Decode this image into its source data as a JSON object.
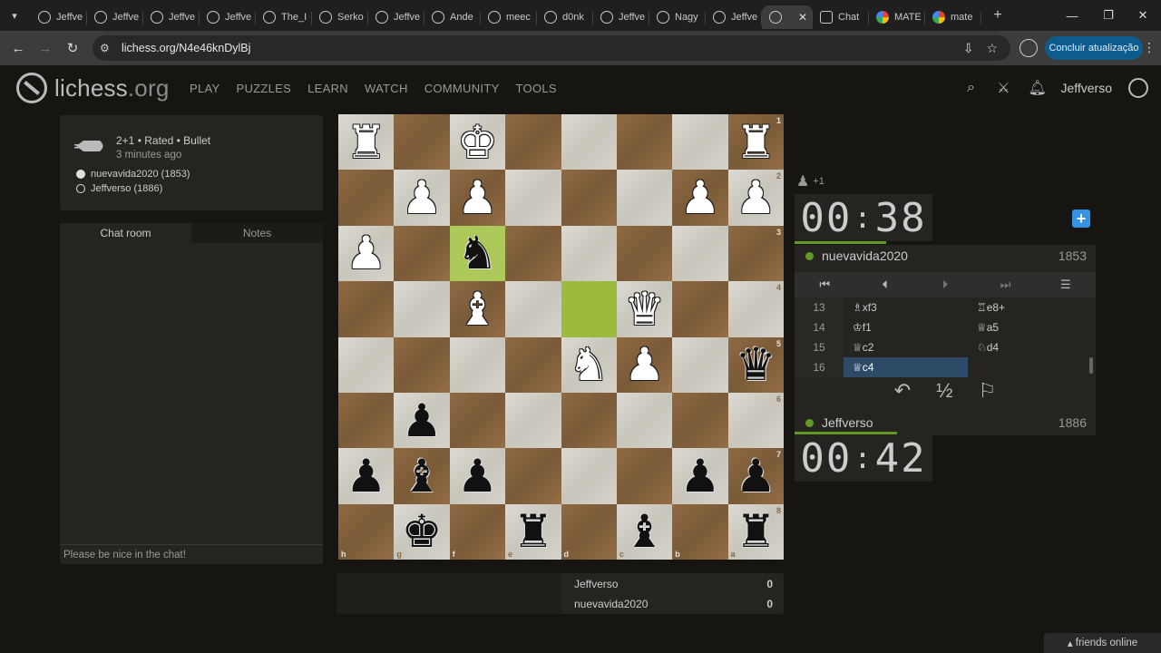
{
  "browser": {
    "tabs": [
      "Jeffve",
      "Jeffve",
      "Jeffve",
      "Jeffve",
      "The_I",
      "Serko",
      "Jeffve",
      "Ande",
      "meec",
      "d0nk",
      "Jeffve",
      "Nagy",
      "Jeffve",
      "",
      "Chat",
      "MATE",
      "mate"
    ],
    "active_tab_index": 13,
    "url": "lichess.org/N4e46knDylBj",
    "update_label": "Concluir atualização"
  },
  "site": {
    "logo_main": "lichess",
    "logo_suffix": ".org",
    "nav": [
      "PLAY",
      "PUZZLES",
      "LEARN",
      "WATCH",
      "COMMUNITY",
      "TOOLS"
    ],
    "username": "Jeffverso"
  },
  "game_meta": {
    "line1": "2+1 • Rated • Bullet",
    "line2": "3 minutes ago",
    "white_player": "nuevavida2020 (1853)",
    "black_player": "Jeffverso (1886)"
  },
  "chat": {
    "tab_chat": "Chat room",
    "tab_notes": "Notes",
    "placeholder": "Please be nice in the chat!"
  },
  "board": {
    "rows": [
      [
        "wR",
        "",
        "wK",
        "",
        "",
        "",
        "",
        "wR"
      ],
      [
        "",
        "wP",
        "wP",
        "",
        "",
        "",
        "wP",
        "wP"
      ],
      [
        "wP",
        "",
        "bN",
        "",
        "",
        "",
        "",
        ""
      ],
      [
        "",
        "",
        "wB",
        "",
        "",
        "wQ",
        "",
        ""
      ],
      [
        "",
        "",
        "",
        "",
        "wN",
        "wP",
        "",
        "bQ"
      ],
      [
        "",
        "bP",
        "",
        "",
        "",
        "",
        "",
        ""
      ],
      [
        "bP",
        "bB",
        "bP",
        "",
        "",
        "",
        "bP",
        "bP"
      ],
      [
        "",
        "bK",
        "",
        "bR",
        "",
        "bB",
        "",
        "bR"
      ]
    ],
    "highlight": [
      [
        2,
        2
      ],
      [
        3,
        4
      ]
    ],
    "ranks": [
      "1",
      "2",
      "3",
      "4",
      "5",
      "6",
      "7",
      "8"
    ],
    "files": [
      "h",
      "g",
      "f",
      "e",
      "d",
      "c",
      "b",
      "a"
    ]
  },
  "crosstable": [
    {
      "name": "Jeffverso",
      "score": "0"
    },
    {
      "name": "nuevavida2020",
      "score": "0"
    }
  ],
  "material": "+1",
  "top_clock": {
    "min": "00",
    "sec": "38"
  },
  "top_player": {
    "name": "nuevavida2020",
    "rating": "1853"
  },
  "bottom_clock": {
    "min": "00",
    "sec": "42"
  },
  "bottom_player": {
    "name": "Jeffverso",
    "rating": "1886"
  },
  "moves": [
    {
      "n": "13",
      "w": "♗xf3",
      "b": "♖e8+"
    },
    {
      "n": "14",
      "w": "♔f1",
      "b": "♕a5"
    },
    {
      "n": "15",
      "w": "♕c2",
      "b": "♘d4"
    },
    {
      "n": "16",
      "w": "♕c4",
      "b": ""
    }
  ],
  "footer": {
    "friends": "friends online"
  }
}
